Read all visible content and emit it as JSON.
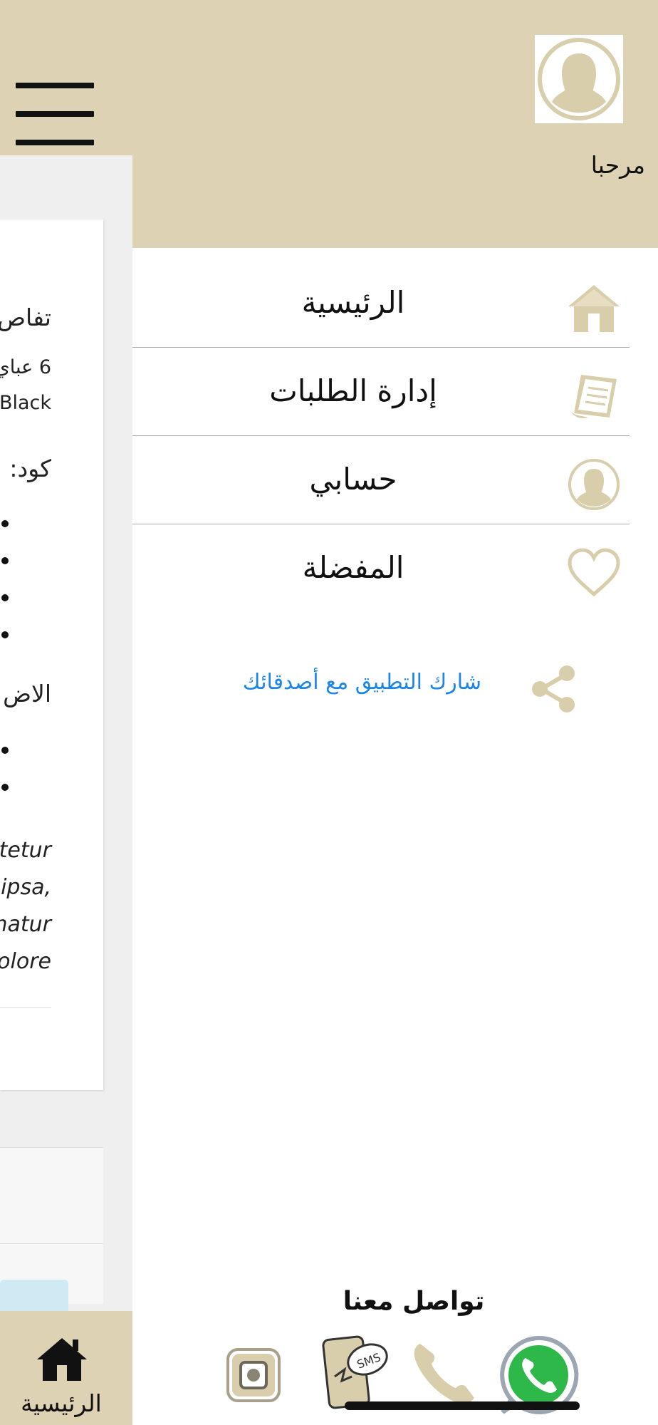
{
  "background_page": {
    "card": {
      "title": "تفاص",
      "sub_line_1": "6 عباي",
      "sub_line_2": "Black",
      "code_label": "كود:",
      "extras_label": "الاض",
      "lorem_lines": [
        "tetur",
        "ipsa,",
        "natur",
        "olore"
      ]
    },
    "tabbar": {
      "home_label": "الرئيسية"
    }
  },
  "drawer": {
    "greeting": "مرحبا",
    "menu": [
      {
        "label": "الرئيسية",
        "icon": "home-icon"
      },
      {
        "label": "إدارة الطلبات",
        "icon": "orders-icon"
      },
      {
        "label": "حسابي",
        "icon": "account-icon"
      },
      {
        "label": "المفضلة",
        "icon": "heart-icon"
      }
    ],
    "share_label": "شارك التطبيق مع أصدقائك",
    "contact_title": "تواصل معنا",
    "contact_icons": [
      "instagram-icon",
      "sms-icon",
      "phone-icon",
      "whatsapp-icon"
    ]
  },
  "colors": {
    "header_bg": "#ddd3b4",
    "accent_icon": "#d9ceab",
    "link": "#1c86e8"
  }
}
